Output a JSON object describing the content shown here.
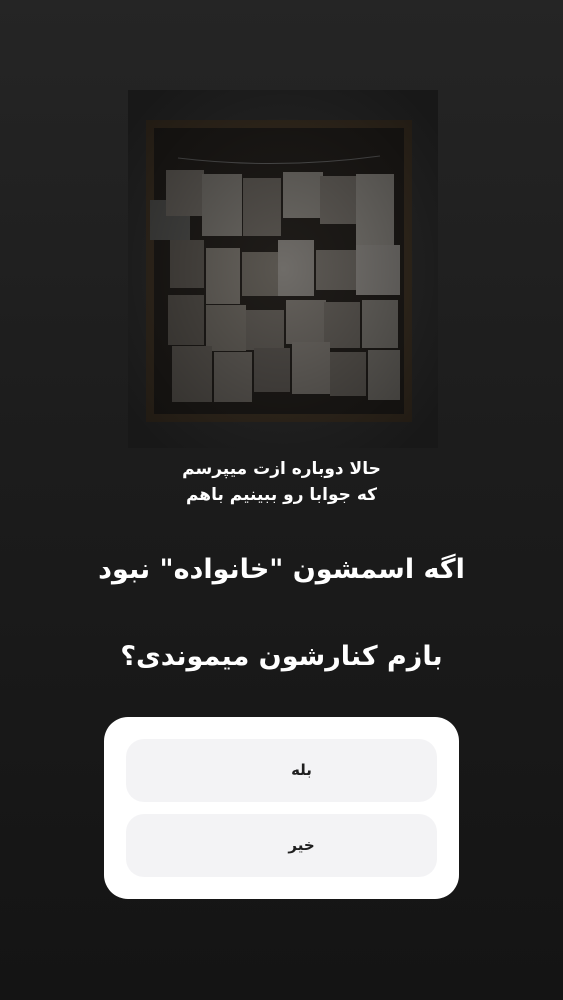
{
  "story": {
    "subtitle_line1": "حالا دوباره ازت میپرسم",
    "subtitle_line2": "که جوابا رو ببینیم باهم",
    "question_line1": "اگه اسمشون \"خانواده\" نبود",
    "question_line2": "بازم کنارشون میموندی؟"
  },
  "poll": {
    "options": [
      {
        "label": "بله"
      },
      {
        "label": "خیر"
      }
    ]
  },
  "colors": {
    "background_top": "#252525",
    "background_bottom": "#141414",
    "poll_card": "#ffffff",
    "poll_option": "#f3f3f5",
    "text": "#ffffff"
  }
}
